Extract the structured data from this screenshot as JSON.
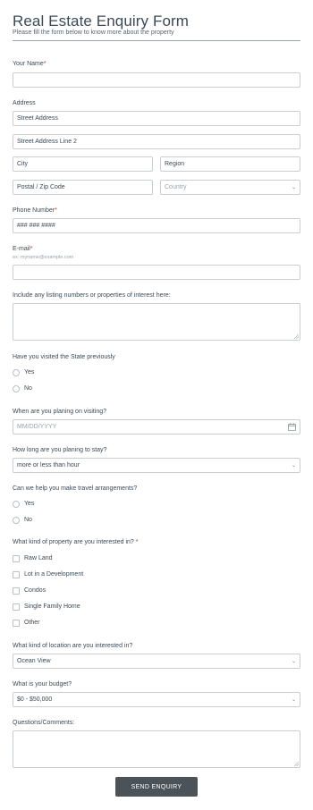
{
  "header": {
    "title": "Real Estate Enquiry Form",
    "subtitle": "Please fill the form below to know more about the property"
  },
  "name": {
    "label": "Your Name",
    "required_mark": "*",
    "value": ""
  },
  "address": {
    "label": "Address",
    "street1_placeholder": "Street Address",
    "street2_placeholder": "Street Address Line 2",
    "city_placeholder": "City",
    "region_placeholder": "Region",
    "postal_placeholder": "Postal / Zip Code",
    "country_placeholder": "Country"
  },
  "phone": {
    "label": "Phone Number",
    "required_mark": "*",
    "placeholder": "### ### ####"
  },
  "email": {
    "label": "E-mail",
    "required_mark": "*",
    "sublabel": "ex: myname@example.com",
    "value": ""
  },
  "listings": {
    "label": "Include any listing numbers or properties of interest here:"
  },
  "visited": {
    "label": "Have you visited the State previously",
    "options": [
      "Yes",
      "No"
    ]
  },
  "visit_date": {
    "label": "When are you planing on visiting?",
    "placeholder": "MM/DD/YYYY",
    "icon": "calendar-icon"
  },
  "stay": {
    "label": "How long are you planing to stay?",
    "selected": "more or less than hour"
  },
  "travel": {
    "label": "Can we help you make travel arrangements?",
    "options": [
      "Yes",
      "No"
    ]
  },
  "property": {
    "label": "What kind of property are you interested in?",
    "required_mark": "*",
    "options": [
      "Raw Land",
      "Lot in a Development",
      "Condos",
      "Single Family Home",
      "Other"
    ]
  },
  "location": {
    "label": "What kind of location are you interested in?",
    "selected": "Ocean View"
  },
  "budget": {
    "label": "What is your budget?",
    "selected": "$0 - $50,000"
  },
  "comments": {
    "label": "Questions/Comments:"
  },
  "submit": {
    "label": "SEND ENQUIRY"
  },
  "colors": {
    "button_bg": "#4b5258",
    "required": "#c0392b",
    "border": "#c9ced3"
  }
}
